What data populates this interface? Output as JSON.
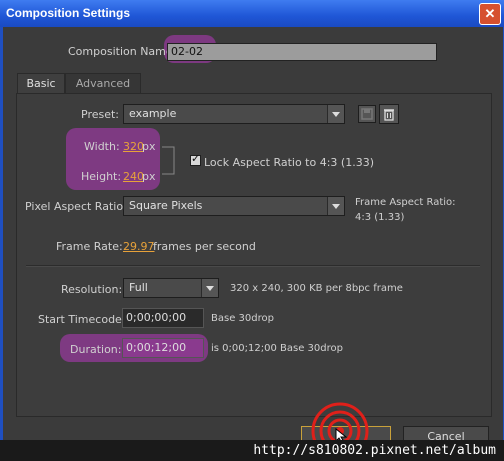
{
  "window": {
    "title": "Composition Settings",
    "close_glyph": "✕"
  },
  "composition_name": {
    "label": "Composition Name:",
    "value": "02-02"
  },
  "tabs": [
    {
      "label": "Basic"
    },
    {
      "label": "Advanced"
    }
  ],
  "preset": {
    "label": "Preset:",
    "value": "example"
  },
  "width": {
    "label": "Width:",
    "value": "320",
    "unit": "px"
  },
  "height": {
    "label": "Height:",
    "value": "240",
    "unit": "px"
  },
  "lock_aspect": {
    "label": "Lock Aspect Ratio to 4:3 (1.33)",
    "checked": true
  },
  "pixel_aspect": {
    "label": "Pixel Aspect Ratio:",
    "value": "Square Pixels"
  },
  "frame_aspect": {
    "label": "Frame Aspect Ratio:",
    "value": "4:3 (1.33)"
  },
  "frame_rate": {
    "label": "Frame Rate:",
    "value": "29.97",
    "unit": "frames per second"
  },
  "resolution": {
    "label": "Resolution:",
    "value": "Full",
    "info": "320 x 240, 300 KB per 8bpc frame"
  },
  "start_timecode": {
    "label": "Start Timecode:",
    "value": "0;00;00;00",
    "info": "Base 30drop"
  },
  "duration": {
    "label": "Duration:",
    "value": "0;00;12;00",
    "info": "is 0;00;12;00  Base 30drop"
  },
  "buttons": {
    "ok": "",
    "cancel": "Cancel"
  },
  "watermark": "http://s810802.pixnet.net/album",
  "icons": {
    "save_preset": "save-preset-icon",
    "delete_preset": "trash-icon"
  },
  "colors": {
    "title_bar": "#1f56d6",
    "highlight": "#8a3a8e",
    "accent": "#e8a23a"
  }
}
